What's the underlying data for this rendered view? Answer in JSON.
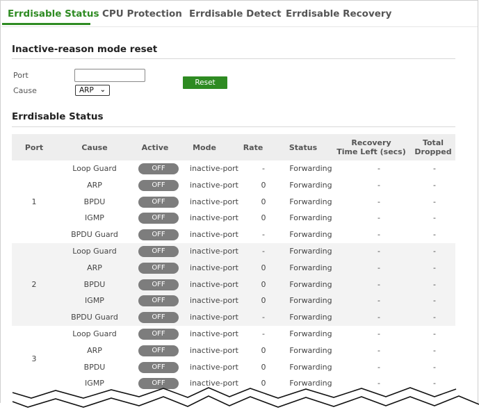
{
  "tabs": [
    {
      "label": "Errdisable Status",
      "active": true
    },
    {
      "label": "CPU Protection",
      "active": false
    },
    {
      "label": "Errdisable Detect",
      "active": false
    },
    {
      "label": "Errdisable Recovery",
      "active": false
    }
  ],
  "reset_section": {
    "title": "Inactive-reason mode reset",
    "port_label": "Port",
    "port_value": "",
    "cause_label": "Cause",
    "cause_selected": "ARP",
    "reset_button": "Reset"
  },
  "status_section": {
    "title": "Errdisable Status",
    "columns": {
      "port": "Port",
      "cause": "Cause",
      "active": "Active",
      "mode": "Mode",
      "rate": "Rate",
      "status": "Status",
      "recovery_l1": "Recovery",
      "recovery_l2": "Time Left (secs)",
      "dropped_l1": "Total",
      "dropped_l2": "Dropped"
    },
    "groups": [
      {
        "port": "1",
        "rows": [
          {
            "cause": "Loop Guard",
            "active": "OFF",
            "mode": "inactive-port",
            "rate": "-",
            "status": "Forwarding",
            "recovery": "-",
            "dropped": "-"
          },
          {
            "cause": "ARP",
            "active": "OFF",
            "mode": "inactive-port",
            "rate": "0",
            "status": "Forwarding",
            "recovery": "-",
            "dropped": "-"
          },
          {
            "cause": "BPDU",
            "active": "OFF",
            "mode": "inactive-port",
            "rate": "0",
            "status": "Forwarding",
            "recovery": "-",
            "dropped": "-"
          },
          {
            "cause": "IGMP",
            "active": "OFF",
            "mode": "inactive-port",
            "rate": "0",
            "status": "Forwarding",
            "recovery": "-",
            "dropped": "-"
          },
          {
            "cause": "BPDU Guard",
            "active": "OFF",
            "mode": "inactive-port",
            "rate": "-",
            "status": "Forwarding",
            "recovery": "-",
            "dropped": "-"
          }
        ]
      },
      {
        "port": "2",
        "rows": [
          {
            "cause": "Loop Guard",
            "active": "OFF",
            "mode": "inactive-port",
            "rate": "-",
            "status": "Forwarding",
            "recovery": "-",
            "dropped": "-"
          },
          {
            "cause": "ARP",
            "active": "OFF",
            "mode": "inactive-port",
            "rate": "0",
            "status": "Forwarding",
            "recovery": "-",
            "dropped": "-"
          },
          {
            "cause": "BPDU",
            "active": "OFF",
            "mode": "inactive-port",
            "rate": "0",
            "status": "Forwarding",
            "recovery": "-",
            "dropped": "-"
          },
          {
            "cause": "IGMP",
            "active": "OFF",
            "mode": "inactive-port",
            "rate": "0",
            "status": "Forwarding",
            "recovery": "-",
            "dropped": "-"
          },
          {
            "cause": "BPDU Guard",
            "active": "OFF",
            "mode": "inactive-port",
            "rate": "-",
            "status": "Forwarding",
            "recovery": "-",
            "dropped": "-"
          }
        ]
      },
      {
        "port": "3",
        "rows": [
          {
            "cause": "Loop Guard",
            "active": "OFF",
            "mode": "inactive-port",
            "rate": "-",
            "status": "Forwarding",
            "recovery": "-",
            "dropped": "-"
          },
          {
            "cause": "ARP",
            "active": "OFF",
            "mode": "inactive-port",
            "rate": "0",
            "status": "Forwarding",
            "recovery": "-",
            "dropped": "-"
          },
          {
            "cause": "BPDU",
            "active": "OFF",
            "mode": "inactive-port",
            "rate": "0",
            "status": "Forwarding",
            "recovery": "-",
            "dropped": "-"
          },
          {
            "cause": "IGMP",
            "active": "OFF",
            "mode": "inactive-port",
            "rate": "0",
            "status": "Forwarding",
            "recovery": "-",
            "dropped": "-"
          }
        ]
      }
    ]
  },
  "colors": {
    "accent": "#2e8b22",
    "pill": "#7d7d7d",
    "header_bg": "#eeeeee",
    "alt_group_bg": "#f3f3f3"
  }
}
